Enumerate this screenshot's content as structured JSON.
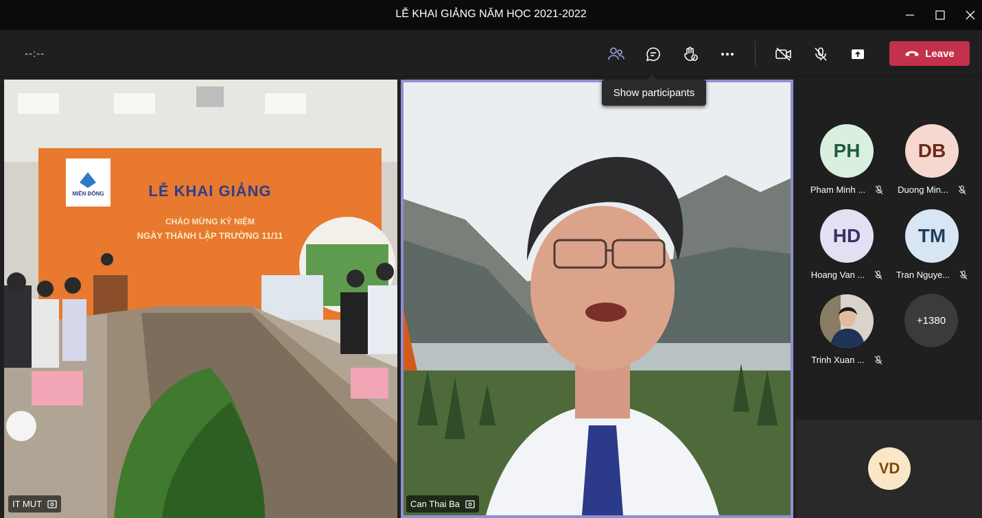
{
  "window": {
    "title": "LỄ KHAI GIẢNG NĂM HỌC 2021-2022"
  },
  "toolbar": {
    "timer": "--:--",
    "leave_label": "Leave",
    "tooltip": "Show participants",
    "icons": [
      "participants-icon",
      "chat-icon",
      "raise-hand-icon",
      "more-icon",
      "camera-off-icon",
      "mic-off-icon",
      "share-icon",
      "phone-icon"
    ]
  },
  "videos": {
    "left": {
      "name": "IT MUT",
      "slide": {
        "line1": "LỄ KHAI GIẢNG",
        "line2": "CHÀO MỪNG KỶ NIỆM",
        "line3": "NGÀY THÀNH LẬP TRƯỜNG 11/11",
        "logo": "MIỀN ĐÔNG"
      }
    },
    "right": {
      "name": "Can Thai Ba"
    }
  },
  "participants": [
    {
      "initials": "PH",
      "name": "Pham Minh ...",
      "color": "#d9f0e0",
      "text_color": "#1f5c3a"
    },
    {
      "initials": "DB",
      "name": "Duong Min...",
      "color": "#f6d8d0",
      "text_color": "#6b2a1d"
    },
    {
      "initials": "HD",
      "name": "Hoang Van ...",
      "color": "#e4e0f3",
      "text_color": "#3a3066"
    },
    {
      "initials": "TM",
      "name": "Tran Nguye...",
      "color": "#d8e6f3",
      "text_color": "#1f3d5c"
    },
    {
      "initials": "",
      "name": "Trinh Xuan ...",
      "color": "#5a6a7c",
      "text_color": "#ffffff"
    }
  ],
  "overflow_count": "+1380",
  "self": {
    "initials": "VD",
    "color": "#fbe6c7"
  },
  "colors": {
    "accent": "#8f8fd1",
    "leave": "#c4314b",
    "background": "#1f1f1f"
  }
}
